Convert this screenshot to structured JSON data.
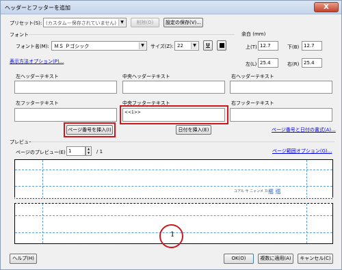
{
  "window": {
    "title": "ヘッダーとフッターを追加",
    "close": "X"
  },
  "preset": {
    "label": "プリセット(S):",
    "value": "(カスタム－保存されていません)",
    "delete": "削除(D)",
    "save": "設定の保存(V)..."
  },
  "font": {
    "group": "フォント",
    "name_label": "フォント名(M):",
    "name_value": "ＭＳ Ｐゴシック",
    "size_label": "サイズ(Z):",
    "size_value": "22",
    "underline": "U"
  },
  "margin": {
    "group": "余白 (mm)",
    "top_label": "上(T)",
    "top_value": "12.7",
    "bottom_label": "下(B)",
    "bottom_value": "12.7",
    "left_label": "左(L)",
    "left_value": "25.4",
    "right_label": "右(R)",
    "right_value": "25.4"
  },
  "display_options_link": "表示方法オプション(P)...",
  "header": {
    "left": "左ヘッダーテキスト",
    "center": "中央ヘッダーテキスト",
    "right": "右ヘッダーテキスト"
  },
  "footer": {
    "left": "左フッターテキスト",
    "center": "中央フッターテキスト",
    "right": "右フッターテキスト",
    "center_value": "<<1>>"
  },
  "insert_page_number": "ページ番号を挿入(I)",
  "insert_date": "日付を挿入(E)",
  "page_number_format_link": "ページ番号と日付の書式(A)...",
  "preview": {
    "group": "プレビュー",
    "page_label": "ページのプレビュー(E)",
    "page_value": "1",
    "page_total": "/ 1",
    "range_link": "ページ範囲オプション(G)...",
    "footer_number": "1",
    "text_gray": "ユアル サ ニャンメ カ シ",
    "text_blue": "擂 擂"
  },
  "buttons": {
    "help": "ヘルプ(H)",
    "ok": "OK(O)",
    "apply_multiple": "複数に適用(A)",
    "cancel": "キャンセル(C)"
  }
}
